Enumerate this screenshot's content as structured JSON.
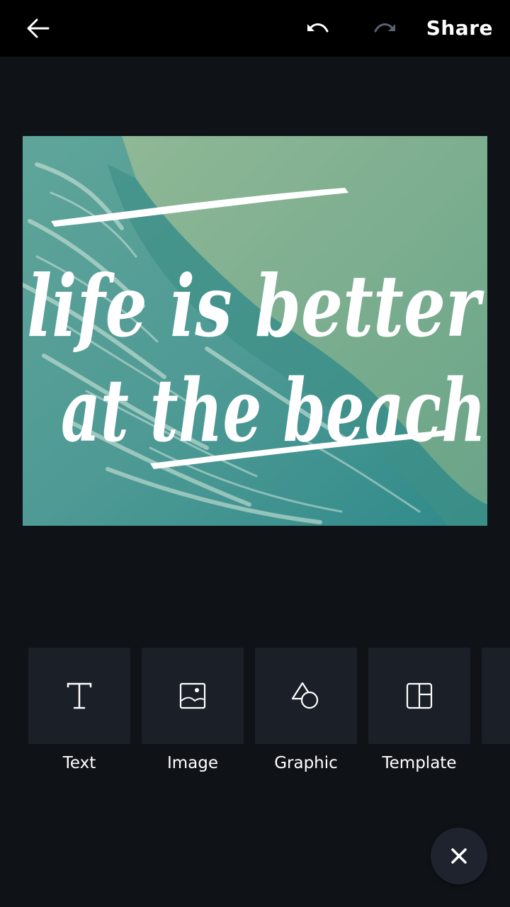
{
  "topbar": {
    "back_icon": "arrow-left-icon",
    "undo_icon": "undo-icon",
    "redo_icon": "redo-icon",
    "share_label": "Share"
  },
  "design": {
    "line1": "life is better",
    "line2": "at the beach",
    "background": "aerial beach with turquoise waves"
  },
  "tools": [
    {
      "label": "Text",
      "icon": "text-icon"
    },
    {
      "label": "Image",
      "icon": "image-icon"
    },
    {
      "label": "Graphic",
      "icon": "shapes-icon"
    },
    {
      "label": "Template",
      "icon": "template-icon"
    }
  ],
  "fab": {
    "icon": "close-icon"
  },
  "colors": {
    "background": "#0f1318",
    "topbar": "#000000",
    "tile": "#1b1f28",
    "fab": "#1f232d",
    "redo_disabled": "#5a6272"
  }
}
